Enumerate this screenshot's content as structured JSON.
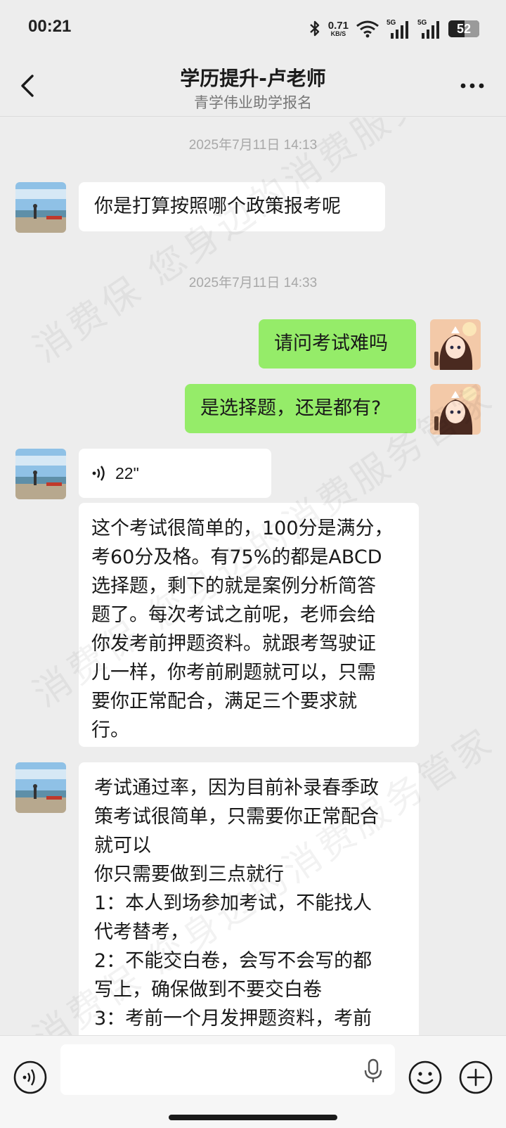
{
  "status_bar": {
    "time": "00:21",
    "net_speed_value": "0.71",
    "net_speed_unit": "KB/S",
    "signal_1_label": "5G",
    "signal_2_label": "5G",
    "battery_level": "52",
    "battery_fraction": 0.52
  },
  "nav": {
    "title": "学历提升-卢老师",
    "subtitle": "青学伟业助学报名"
  },
  "messages": {
    "ts1": "2025年7月11日 14:13",
    "m1": "你是打算按照哪个政策报考呢",
    "ts2": "2025年7月11日 14:33",
    "m2": "请问考试难吗",
    "m3": "是选择题，还是都有?",
    "voice_duration": "22\"",
    "m4": "这个考试很简单的，100分是满分，\n考60分及格。有75%的都是ABCD\n选择题，剩下的就是案例分析简答\n题了。每次考试之前呢，老师会给\n你发考前押题资料。就跟考驾驶证\n儿一样，你考前刷题就可以，只需\n要你正常配合，满足三个要求就\n行。",
    "m5": "考试通过率，因为目前补录春季政\n策考试很简单，只需要你正常配合\n就可以\n你只需要做到三点就行\n1：本人到场参加考试，不能找人\n代考替考，\n2：不能交白卷，会写不会写的都\n写上，确保做到不要交白卷\n3：考前一个月发押题资料，考前"
  },
  "watermark": {
    "line1": "消费保 您身边的消费服务管家",
    "line2": "消费保 您身边的消费服务管家",
    "line3": "消费保 您身边的消费服务管家"
  },
  "colors": {
    "outgoing_bubble": "#95ec69",
    "incoming_bubble": "#ffffff",
    "background": "#ededed"
  },
  "icons": {
    "back": "chevron-left-icon",
    "more": "more-dots-icon",
    "voice_toggle": "voice-icon",
    "mic": "microphone-icon",
    "emoji": "emoji-icon",
    "plus": "plus-icon"
  }
}
